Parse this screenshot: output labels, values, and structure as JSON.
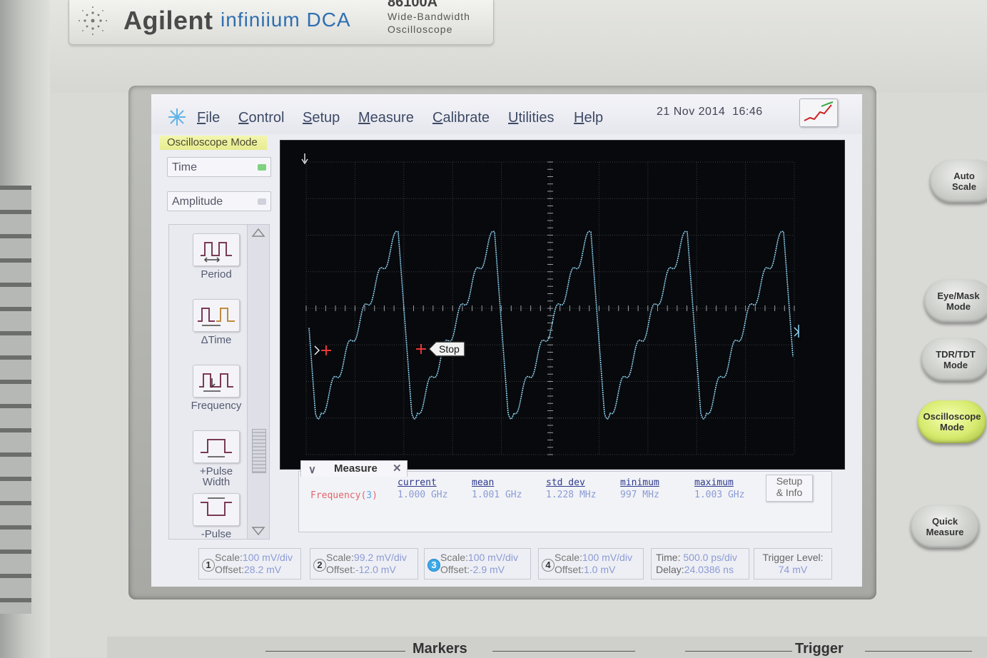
{
  "instrument": {
    "brand": "Agilent",
    "product": "infiniium DCA",
    "model": "86100A",
    "model_sub_1": "Wide-Bandwidth",
    "model_sub_2": "Oscilloscope",
    "bottom_labels": {
      "markers": "Markers",
      "trigger": "Trigger"
    },
    "side_buttons": [
      {
        "label": "Auto\nScale"
      },
      {
        "label": "Eye/Mask\nMode"
      },
      {
        "label": "TDR/TDT\nMode"
      },
      {
        "label": "Oscilloscope\nMode",
        "lit": true
      },
      {
        "label": "Quick\nMeasure"
      }
    ]
  },
  "menubar": {
    "items": [
      "File",
      "Control",
      "Setup",
      "Measure",
      "Calibrate",
      "Utilities",
      "Help"
    ],
    "date": "21 Nov 2014",
    "time": "16:46"
  },
  "left_panel": {
    "mode_label": "Oscilloscope Mode",
    "time_combo": "Time",
    "amplitude_combo": "Amplitude",
    "measurements": [
      {
        "label": "Period",
        "icon": "period-icon"
      },
      {
        "label": "ΔTime",
        "icon": "delta-time-icon"
      },
      {
        "label": "Frequency",
        "icon": "frequency-icon"
      },
      {
        "label": "+Pulse\nWidth",
        "icon": "positive-pulse-width-icon"
      },
      {
        "label": "-Pulse\nWidth",
        "icon": "negative-pulse-width-icon"
      }
    ]
  },
  "waveform": {
    "stop_marker": "Stop",
    "trace_color": "#8fd2f2",
    "cursor_color": "#ff3b3b"
  },
  "measure_panel": {
    "tab_label": "Measure",
    "row_label": "Frequency(",
    "row_channel": "3",
    "row_close": ")",
    "columns": [
      {
        "head": "current",
        "value": "1.000 GHz"
      },
      {
        "head": "mean",
        "value": "1.001 GHz"
      },
      {
        "head": "std dev",
        "value": "1.228 MHz"
      },
      {
        "head": "minimum",
        "value": "997 MHz"
      },
      {
        "head": "maximum",
        "value": "1.003 GHz"
      }
    ],
    "setup_info": "Setup\n& Info"
  },
  "status_bar": {
    "channels": [
      {
        "num": "1",
        "scale_label": "Scale:",
        "scale": "100 mV/div",
        "offset_label": "Offset:",
        "offset": "28.2 mV",
        "active": false
      },
      {
        "num": "2",
        "scale_label": "Scale:",
        "scale": "99.2 mV/div",
        "offset_label": "Offset:",
        "offset": "-12.0 mV",
        "active": false
      },
      {
        "num": "3",
        "scale_label": "Scale:",
        "scale": "100 mV/div",
        "offset_label": "Offset:",
        "offset": "-2.9 mV",
        "active": true
      },
      {
        "num": "4",
        "scale_label": "Scale:",
        "scale": "100 mV/div",
        "offset_label": "Offset:",
        "offset": "1.0 mV",
        "active": false
      }
    ],
    "time_label": "Time:",
    "time_value": "500.0 ps/div",
    "delay_label": "Delay:",
    "delay_value": "24.0386 ns",
    "trigger_label": "Trigger Level:",
    "trigger_value": "74 mV"
  }
}
